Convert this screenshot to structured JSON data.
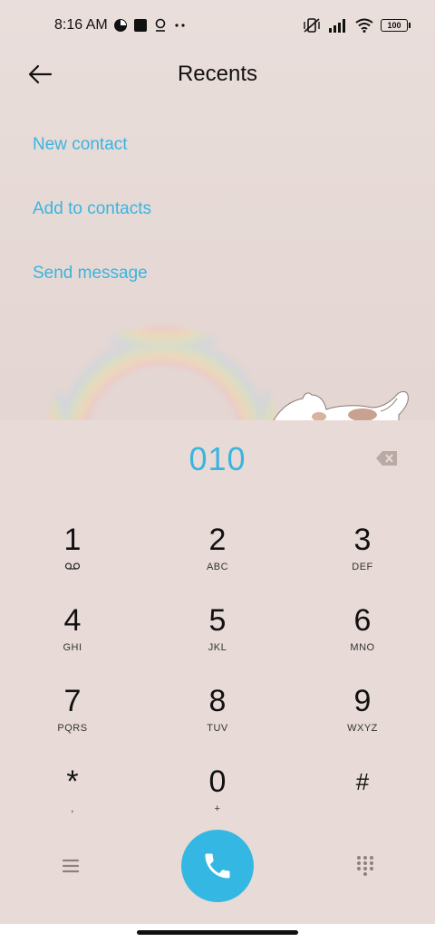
{
  "status_bar": {
    "time": "8:16 AM",
    "icons": [
      "data-saver-icon",
      "square-notification-icon",
      "location-icon",
      "more-dots-icon",
      "mute-vibrate-icon",
      "signal-icon",
      "wifi-icon"
    ],
    "battery": "100"
  },
  "header": {
    "title": "Recents",
    "back_icon": "arrow-left-icon"
  },
  "actions": [
    {
      "label": "New contact"
    },
    {
      "label": "Add to contacts"
    },
    {
      "label": "Send message"
    }
  ],
  "dialer": {
    "number": "010",
    "keys": [
      {
        "digit": "1",
        "letters": ""
      },
      {
        "digit": "2",
        "letters": "ABC"
      },
      {
        "digit": "3",
        "letters": "DEF"
      },
      {
        "digit": "4",
        "letters": "GHI"
      },
      {
        "digit": "5",
        "letters": "JKL"
      },
      {
        "digit": "6",
        "letters": "MNO"
      },
      {
        "digit": "7",
        "letters": "PQRS"
      },
      {
        "digit": "8",
        "letters": "TUV"
      },
      {
        "digit": "9",
        "letters": "WXYZ"
      },
      {
        "digit": "*",
        "letters": ","
      },
      {
        "digit": "0",
        "letters": "+"
      },
      {
        "digit": "#",
        "letters": ""
      }
    ]
  },
  "colors": {
    "accent": "#3ab4e0",
    "call_button": "#34b8e3",
    "background": "#e8dbd7"
  }
}
